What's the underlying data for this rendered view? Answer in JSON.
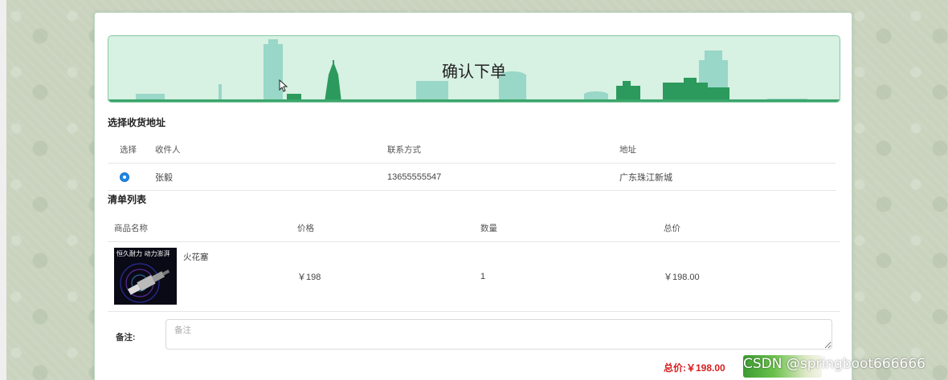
{
  "banner": {
    "title": "确认下单"
  },
  "address": {
    "section_title": "选择收货地址",
    "headers": {
      "select": "选择",
      "receiver": "收件人",
      "contact": "联系方式",
      "address": "地址"
    },
    "rows": [
      {
        "receiver": "张毅",
        "contact": "13655555547",
        "address": "广东珠江新城",
        "selected": true
      }
    ]
  },
  "cart": {
    "section_title": "清单列表",
    "headers": {
      "name": "商品名称",
      "price": "价格",
      "quantity": "数量",
      "total": "总价"
    },
    "items": [
      {
        "image_caption": "恒久耐力 动力澎湃",
        "name": "火花塞",
        "price": "￥198",
        "quantity": "1",
        "total": "￥198.00"
      }
    ]
  },
  "remark": {
    "label": "备注:",
    "placeholder": "备注"
  },
  "summary": {
    "total_text": "总价:￥198.00"
  },
  "watermark": "CSDN @springboot666666",
  "colors": {
    "accent_green": "#3aa56b",
    "price_red": "#d62020",
    "radio_blue": "#1e88e5"
  }
}
